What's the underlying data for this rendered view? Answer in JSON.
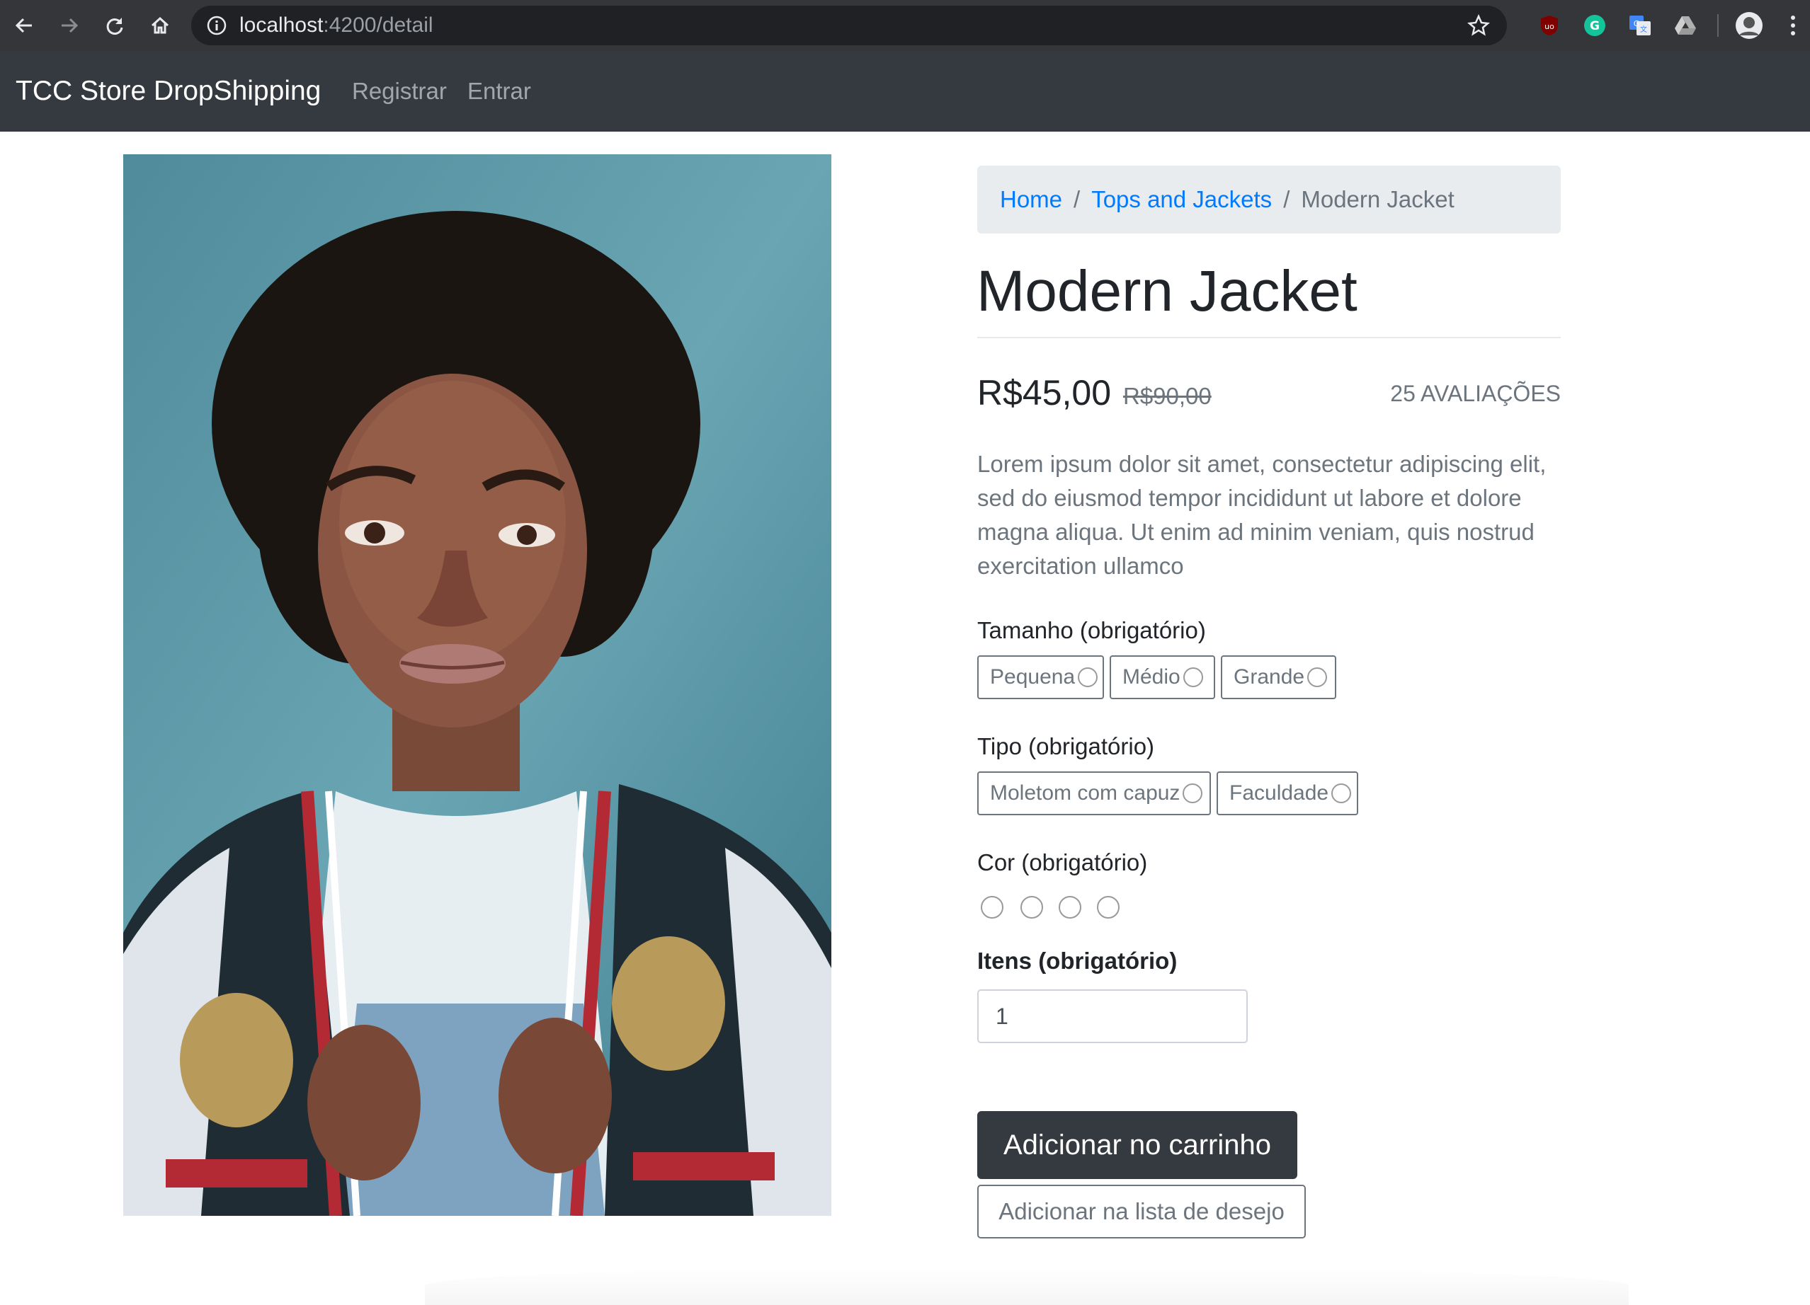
{
  "browser": {
    "url_host": "localhost",
    "url_path": ":4200/detail"
  },
  "navbar": {
    "brand": "TCC Store DropShipping",
    "links": [
      "Registrar",
      "Entrar"
    ]
  },
  "breadcrumb": {
    "items": [
      "Home",
      "Tops and Jackets"
    ],
    "active": "Modern Jacket"
  },
  "product": {
    "title": "Modern Jacket",
    "price": "R$45,00",
    "old_price": "R$90,00",
    "reviews": "25 AVALIAÇÕES",
    "description": "Lorem ipsum dolor sit amet, consectetur adipiscing elit, sed do eiusmod tempor incididunt ut labore et dolore magna aliqua. Ut enim ad minim veniam, quis nostrud exercitation ullamco"
  },
  "options": {
    "size_label": "Tamanho (obrigatório)",
    "sizes": [
      "Pequena",
      "Médio",
      "Grande"
    ],
    "type_label": "Tipo (obrigatório)",
    "types": [
      "Moletom com capuz",
      "Faculdade"
    ],
    "color_label": "Cor (obrigatório)",
    "items_label": "Itens (obrigatório)",
    "quantity": "1"
  },
  "actions": {
    "add_to_cart": "Adicionar no carrinho",
    "add_to_wishlist": "Adicionar na lista de desejo"
  },
  "colors": {
    "navbar_bg": "#343a40",
    "link": "#007bff",
    "muted": "#6c757d"
  }
}
